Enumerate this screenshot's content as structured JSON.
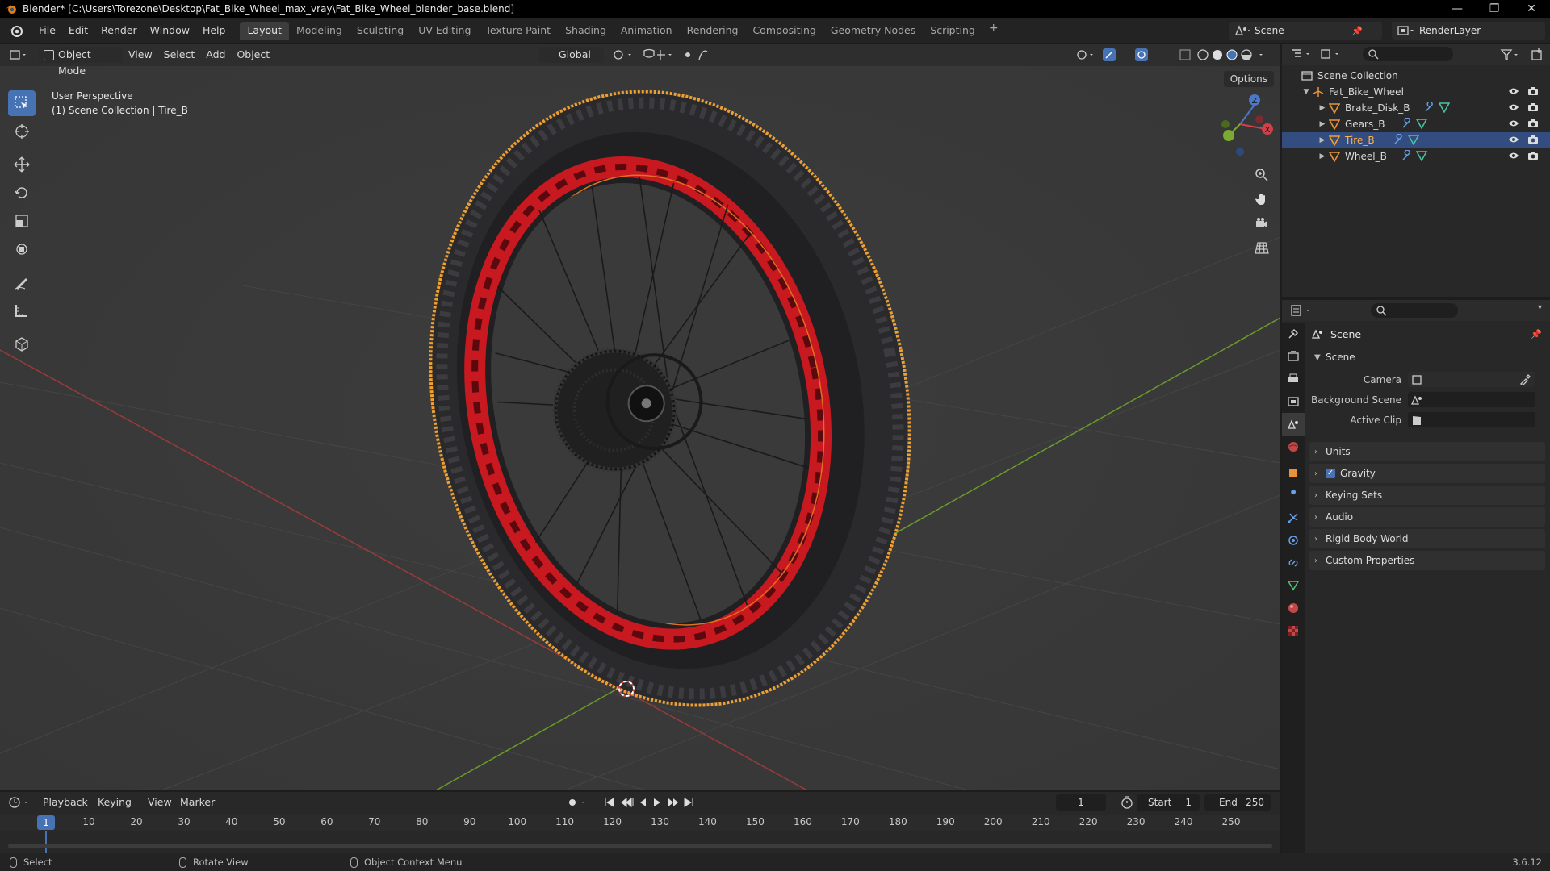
{
  "window": {
    "title": "Blender* [C:\\Users\\Torezone\\Desktop\\Fat_Bike_Wheel_max_vray\\Fat_Bike_Wheel_blender_base.blend]",
    "minimize": "—",
    "maximize": "❐",
    "close": "✕"
  },
  "menu": {
    "items": [
      "File",
      "Edit",
      "Render",
      "Window",
      "Help"
    ]
  },
  "workspaces": {
    "tabs": [
      "Layout",
      "Modeling",
      "Sculpting",
      "UV Editing",
      "Texture Paint",
      "Shading",
      "Animation",
      "Rendering",
      "Compositing",
      "Geometry Nodes",
      "Scripting"
    ],
    "active": "Layout",
    "add": "+"
  },
  "scene_selector": {
    "value": "Scene"
  },
  "renderlayer_selector": {
    "value": "RenderLayer"
  },
  "viewport": {
    "mode": "Object Mode",
    "menus": [
      "View",
      "Select",
      "Add",
      "Object"
    ],
    "orientation": "Global",
    "options": "Options",
    "info_line1": "User Perspective",
    "info_line2": "(1) Scene Collection | Tire_B",
    "colors": {
      "grid_bg": "#3a3a3a",
      "x_axis": "#9a3a3a",
      "y_axis": "#6a9a2a",
      "selection": "#f0a030",
      "rim": "#c81820",
      "tire": "#2a2a2c"
    },
    "gizmo": {
      "x": "X",
      "y": "Y",
      "z": "Z"
    }
  },
  "outliner": {
    "root": "Scene Collection",
    "collection": "Fat_Bike_Wheel",
    "objects": [
      {
        "name": "Brake_Disk_B",
        "selected": false
      },
      {
        "name": "Gears_B",
        "selected": false
      },
      {
        "name": "Tire_B",
        "selected": true
      },
      {
        "name": "Wheel_B",
        "selected": false
      }
    ]
  },
  "properties": {
    "context": "Scene",
    "panel_scene": "Scene",
    "camera_label": "Camera",
    "background_label": "Background Scene",
    "clip_label": "Active Clip",
    "panels": [
      "Units",
      "Gravity",
      "Keying Sets",
      "Audio",
      "Rigid Body World",
      "Custom Properties"
    ],
    "gravity_checked": true
  },
  "timeline": {
    "menus": [
      "Playback",
      "Keying",
      "View",
      "Marker"
    ],
    "current_frame": "1",
    "start_label": "Start",
    "start": "1",
    "end_label": "End",
    "end": "250",
    "ticks": [
      "1",
      "10",
      "20",
      "30",
      "40",
      "50",
      "60",
      "70",
      "80",
      "90",
      "100",
      "110",
      "120",
      "130",
      "140",
      "150",
      "160",
      "170",
      "180",
      "190",
      "200",
      "210",
      "220",
      "230",
      "240",
      "250"
    ]
  },
  "status": {
    "select": "Select",
    "rotate": "Rotate View",
    "context_menu": "Object Context Menu",
    "version": "3.6.12"
  }
}
